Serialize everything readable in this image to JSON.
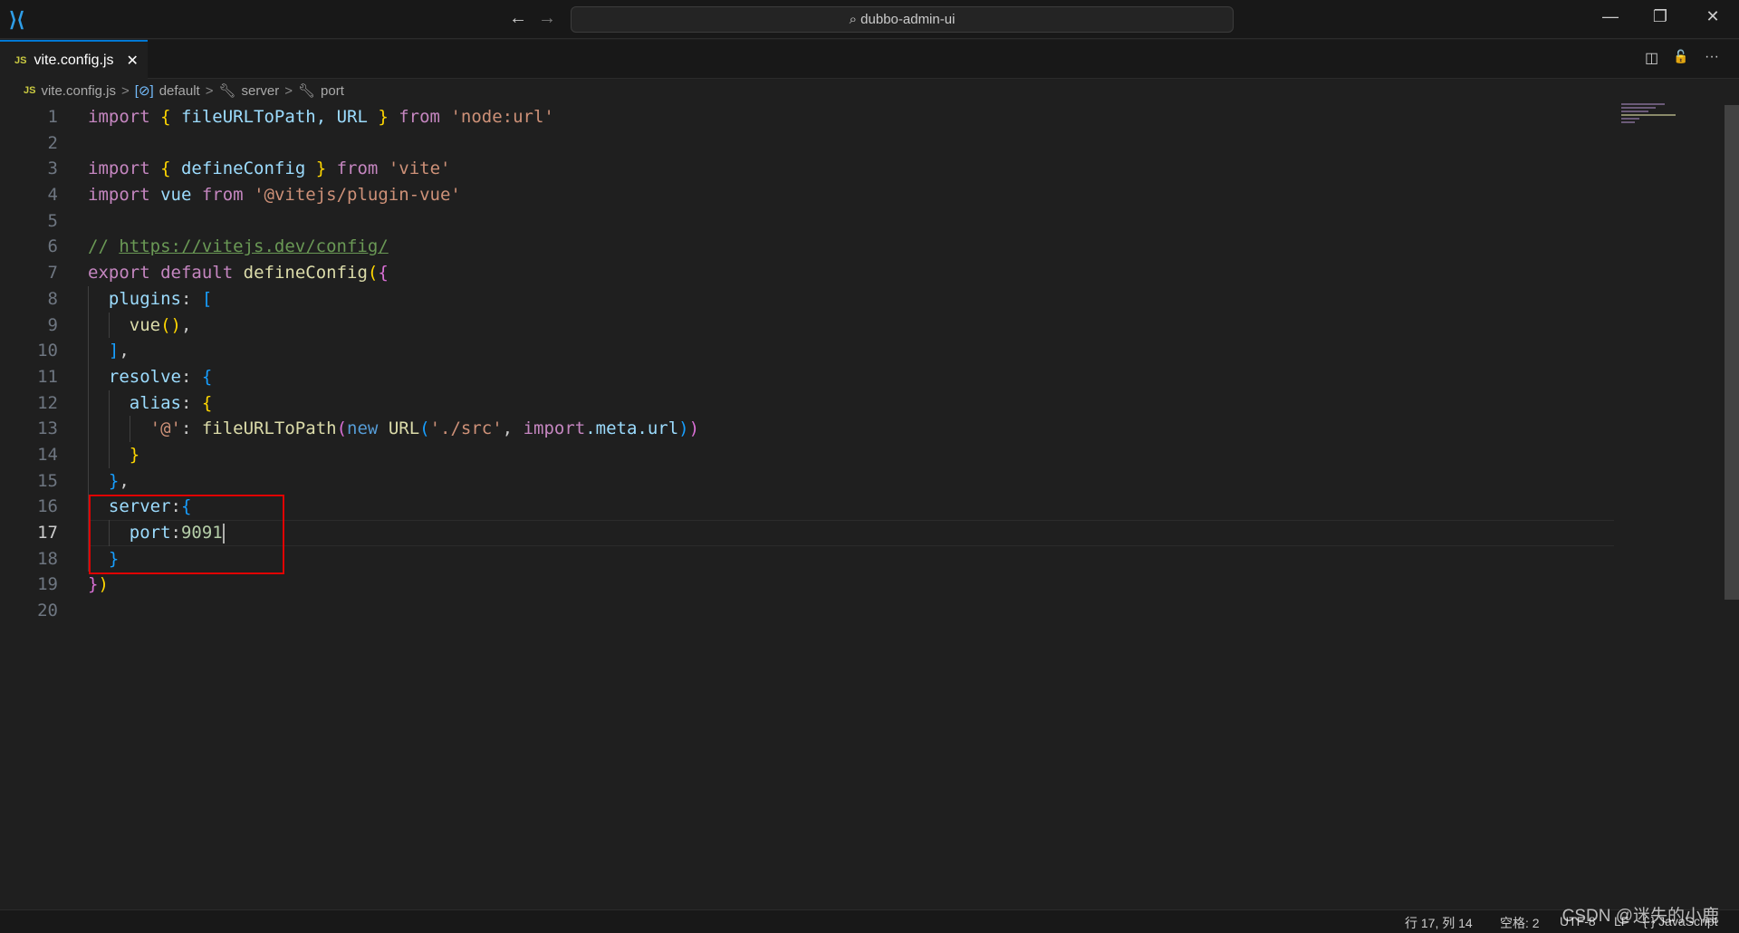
{
  "titlebar": {
    "search_text": "dubbo-admin-ui",
    "back": "←",
    "forward": "→",
    "minimize": "—",
    "restore": "❐",
    "close": "✕"
  },
  "tab": {
    "icon": "JS",
    "label": "vite.config.js",
    "close": "✕"
  },
  "tab_actions": {
    "split": "◫",
    "lock": "🔓",
    "more": "···"
  },
  "breadcrumb": {
    "file": "vite.config.js",
    "items": [
      "default",
      "server",
      "port"
    ],
    "sep": ">"
  },
  "editor": {
    "current_line": 17,
    "lines": [
      [
        [
          "import",
          "kw"
        ],
        [
          " ",
          "p"
        ],
        [
          "{",
          "b1"
        ],
        [
          " fileURLToPath, URL ",
          "v"
        ],
        [
          "}",
          "b1"
        ],
        [
          " ",
          "p"
        ],
        [
          "from",
          "kw"
        ],
        [
          " ",
          "p"
        ],
        [
          "'node:url'",
          "s"
        ]
      ],
      [],
      [
        [
          "import",
          "kw"
        ],
        [
          " ",
          "p"
        ],
        [
          "{",
          "b1"
        ],
        [
          " defineConfig ",
          "v"
        ],
        [
          "}",
          "b1"
        ],
        [
          " ",
          "p"
        ],
        [
          "from",
          "kw"
        ],
        [
          " ",
          "p"
        ],
        [
          "'vite'",
          "s"
        ]
      ],
      [
        [
          "import",
          "kw"
        ],
        [
          " vue ",
          "v"
        ],
        [
          "from",
          "kw"
        ],
        [
          " ",
          "p"
        ],
        [
          "'@vitejs/plugin-vue'",
          "s"
        ]
      ],
      [],
      [
        [
          "// ",
          "c"
        ],
        [
          "https://vitejs.dev/config/",
          "u"
        ]
      ],
      [
        [
          "export",
          "kw"
        ],
        [
          " ",
          "p"
        ],
        [
          "default",
          "kw"
        ],
        [
          " ",
          "p"
        ],
        [
          "defineConfig",
          "f"
        ],
        [
          "(",
          "b1"
        ],
        [
          "{",
          "b2"
        ]
      ],
      [
        [
          "  plugins",
          "v"
        ],
        [
          ": ",
          "p"
        ],
        [
          "[",
          "b3"
        ]
      ],
      [
        [
          "    ",
          "p"
        ],
        [
          "vue",
          "f"
        ],
        [
          "()",
          "b1"
        ],
        [
          ",",
          "p"
        ]
      ],
      [
        [
          "  ",
          "p"
        ],
        [
          "]",
          "b3"
        ],
        [
          ",",
          "p"
        ]
      ],
      [
        [
          "  resolve",
          "v"
        ],
        [
          ": ",
          "p"
        ],
        [
          "{",
          "b3"
        ]
      ],
      [
        [
          "    alias",
          "v"
        ],
        [
          ": ",
          "p"
        ],
        [
          "{",
          "b1"
        ]
      ],
      [
        [
          "      ",
          "p"
        ],
        [
          "'@'",
          "s"
        ],
        [
          ": ",
          "p"
        ],
        [
          "fileURLToPath",
          "f"
        ],
        [
          "(",
          "b2"
        ],
        [
          "new",
          "n"
        ],
        [
          " ",
          "p"
        ],
        [
          "URL",
          "f"
        ],
        [
          "(",
          "b3"
        ],
        [
          "'./src'",
          "s"
        ],
        [
          ", ",
          "p"
        ],
        [
          "import",
          "kw"
        ],
        [
          ".meta.url",
          "v"
        ],
        [
          ")",
          "b3"
        ],
        [
          ")",
          "b2"
        ]
      ],
      [
        [
          "    ",
          "p"
        ],
        [
          "}",
          "b1"
        ]
      ],
      [
        [
          "  ",
          "p"
        ],
        [
          "}",
          "b3"
        ],
        [
          ",",
          "p"
        ]
      ],
      [
        [
          "  server",
          "v"
        ],
        [
          ":",
          "p"
        ],
        [
          "{",
          "b3"
        ]
      ],
      [
        [
          "    port",
          "v"
        ],
        [
          ":",
          "p"
        ],
        [
          "9091",
          "num"
        ]
      ],
      [
        [
          "  ",
          "p"
        ],
        [
          "}",
          "b3"
        ]
      ],
      [
        [
          "}",
          "b2"
        ],
        [
          ")",
          "b1"
        ]
      ],
      []
    ]
  },
  "status": {
    "position": "行 17, 列 14",
    "spaces": "空格: 2",
    "encoding": "UTF-8",
    "eol": "LF",
    "language": "{ } JavaScript"
  },
  "watermark": "CSDN @迷失的小鹿"
}
